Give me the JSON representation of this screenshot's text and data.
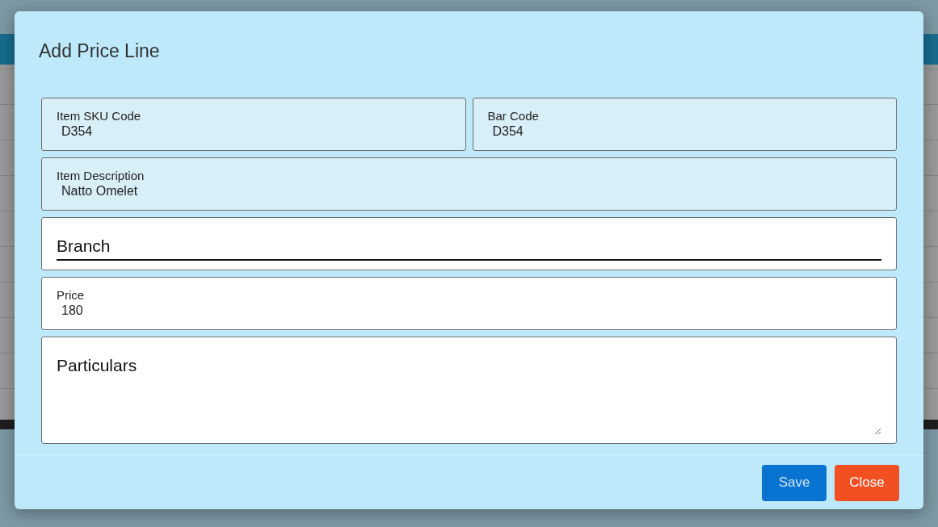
{
  "dialog": {
    "title": "Add Price Line",
    "rows": [
      [
        {
          "kind": "readonly",
          "label": "Item SKU Code",
          "value": "D354"
        },
        {
          "kind": "readonly",
          "label": "Bar Code",
          "value": "D354"
        }
      ],
      [
        {
          "kind": "readonly",
          "label": "Item Description",
          "value": "Natto Omelet"
        }
      ],
      [
        {
          "kind": "select",
          "placeholder": "Branch"
        }
      ],
      [
        {
          "kind": "text",
          "label": "Price",
          "value": "180"
        }
      ],
      [
        {
          "kind": "textarea",
          "placeholder": "Particulars"
        }
      ]
    ],
    "buttons": [
      {
        "kind": "primary",
        "label": "Save"
      },
      {
        "kind": "danger",
        "label": "Close"
      }
    ]
  }
}
